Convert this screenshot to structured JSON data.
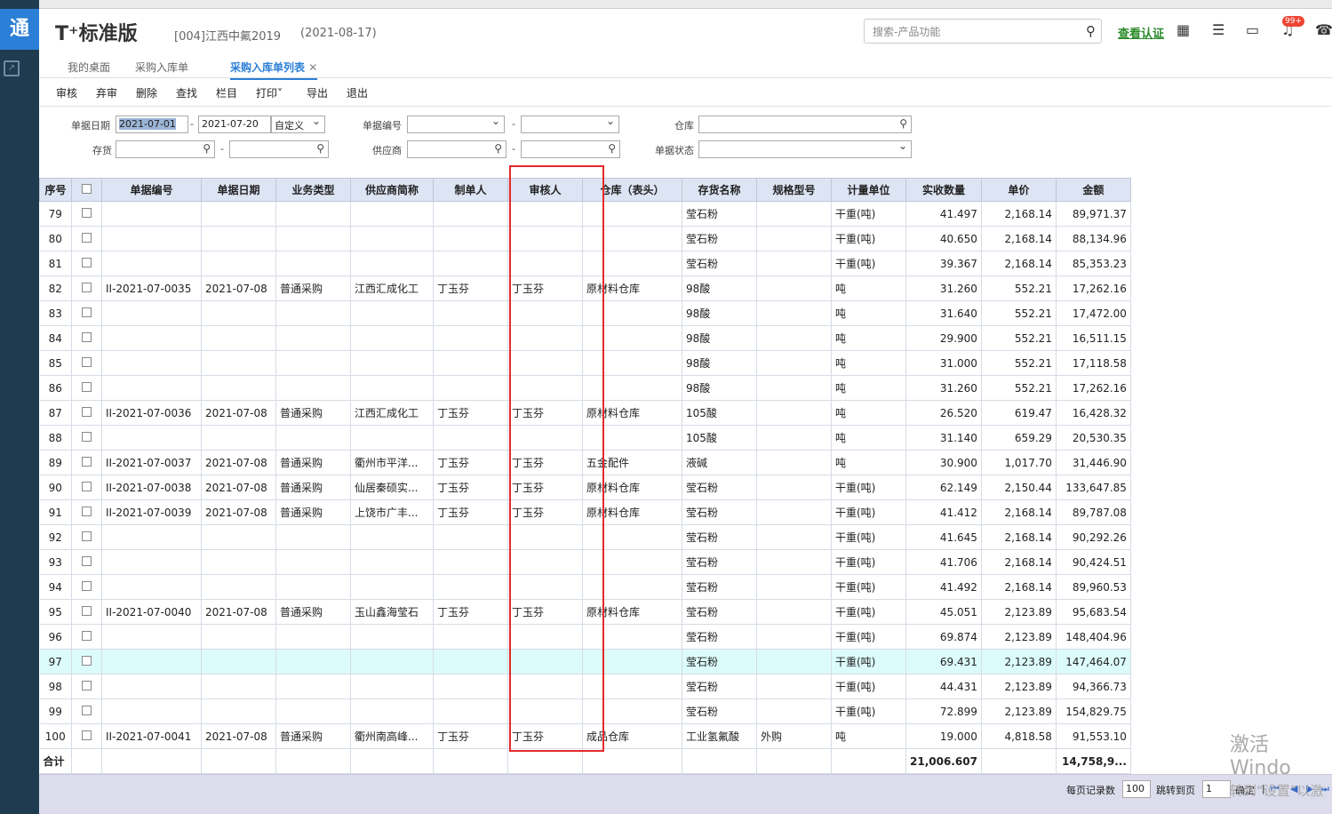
{
  "app": {
    "logo_char": "通",
    "brand": "T⁺标准版",
    "company": "[004]江西中氟2019",
    "date": "(2021-08-17)"
  },
  "header": {
    "search_placeholder": "搜索-产品功能",
    "verify_link": "查看认证",
    "badge": "99+",
    "icons": [
      "calculator-icon",
      "checklist-icon",
      "message-icon",
      "bell-icon",
      "phone-icon"
    ]
  },
  "tabs": [
    "我的桌面",
    "采购入库单",
    "采购入库单列表"
  ],
  "toolbar": [
    "审核",
    "弃审",
    "删除",
    "查找",
    "栏目",
    "打印",
    "导出",
    "退出"
  ],
  "filter": {
    "date_label": "单据日期",
    "date_from": "2021-07-01",
    "date_to": "2021-07-20",
    "date_mode": "自定义",
    "docno_label": "单据编号",
    "warehouse_label": "仓库",
    "inventory_label": "存货",
    "supplier_label": "供应商",
    "status_label": "单据状态",
    "dash": "-"
  },
  "table": {
    "headers": [
      "序号",
      "",
      "单据编号",
      "单据日期",
      "业务类型",
      "供应商简称",
      "制单人",
      "审核人",
      "仓库（表头）",
      "存货名称",
      "规格型号",
      "计量单位",
      "实收数量",
      "单价",
      "金额"
    ],
    "rows": [
      [
        "79",
        "",
        "",
        "",
        "",
        "",
        "",
        "",
        "",
        "莹石粉",
        "",
        "干重(吨)",
        "41.497",
        "2,168.14",
        "89,971.37"
      ],
      [
        "80",
        "",
        "",
        "",
        "",
        "",
        "",
        "",
        "",
        "莹石粉",
        "",
        "干重(吨)",
        "40.650",
        "2,168.14",
        "88,134.96"
      ],
      [
        "81",
        "",
        "",
        "",
        "",
        "",
        "",
        "",
        "",
        "莹石粉",
        "",
        "干重(吨)",
        "39.367",
        "2,168.14",
        "85,353.23"
      ],
      [
        "82",
        "",
        "II-2021-07-0035",
        "2021-07-08",
        "普通采购",
        "江西汇成化工",
        "丁玉芬",
        "丁玉芬",
        "原材料仓库",
        "98酸",
        "",
        "吨",
        "31.260",
        "552.21",
        "17,262.16"
      ],
      [
        "83",
        "",
        "",
        "",
        "",
        "",
        "",
        "",
        "",
        "98酸",
        "",
        "吨",
        "31.640",
        "552.21",
        "17,472.00"
      ],
      [
        "84",
        "",
        "",
        "",
        "",
        "",
        "",
        "",
        "",
        "98酸",
        "",
        "吨",
        "29.900",
        "552.21",
        "16,511.15"
      ],
      [
        "85",
        "",
        "",
        "",
        "",
        "",
        "",
        "",
        "",
        "98酸",
        "",
        "吨",
        "31.000",
        "552.21",
        "17,118.58"
      ],
      [
        "86",
        "",
        "",
        "",
        "",
        "",
        "",
        "",
        "",
        "98酸",
        "",
        "吨",
        "31.260",
        "552.21",
        "17,262.16"
      ],
      [
        "87",
        "",
        "II-2021-07-0036",
        "2021-07-08",
        "普通采购",
        "江西汇成化工",
        "丁玉芬",
        "丁玉芬",
        "原材料仓库",
        "105酸",
        "",
        "吨",
        "26.520",
        "619.47",
        "16,428.32"
      ],
      [
        "88",
        "",
        "",
        "",
        "",
        "",
        "",
        "",
        "",
        "105酸",
        "",
        "吨",
        "31.140",
        "659.29",
        "20,530.35"
      ],
      [
        "89",
        "",
        "II-2021-07-0037",
        "2021-07-08",
        "普通采购",
        "衢州市平洋...",
        "丁玉芬",
        "丁玉芬",
        "五金配件",
        "液碱",
        "",
        "吨",
        "30.900",
        "1,017.70",
        "31,446.90"
      ],
      [
        "90",
        "",
        "II-2021-07-0038",
        "2021-07-08",
        "普通采购",
        "仙居秦硕实...",
        "丁玉芬",
        "丁玉芬",
        "原材料仓库",
        "莹石粉",
        "",
        "干重(吨)",
        "62.149",
        "2,150.44",
        "133,647.85"
      ],
      [
        "91",
        "",
        "II-2021-07-0039",
        "2021-07-08",
        "普通采购",
        "上饶市广丰...",
        "丁玉芬",
        "丁玉芬",
        "原材料仓库",
        "莹石粉",
        "",
        "干重(吨)",
        "41.412",
        "2,168.14",
        "89,787.08"
      ],
      [
        "92",
        "",
        "",
        "",
        "",
        "",
        "",
        "",
        "",
        "莹石粉",
        "",
        "干重(吨)",
        "41.645",
        "2,168.14",
        "90,292.26"
      ],
      [
        "93",
        "",
        "",
        "",
        "",
        "",
        "",
        "",
        "",
        "莹石粉",
        "",
        "干重(吨)",
        "41.706",
        "2,168.14",
        "90,424.51"
      ],
      [
        "94",
        "",
        "",
        "",
        "",
        "",
        "",
        "",
        "",
        "莹石粉",
        "",
        "干重(吨)",
        "41.492",
        "2,168.14",
        "89,960.53"
      ],
      [
        "95",
        "",
        "II-2021-07-0040",
        "2021-07-08",
        "普通采购",
        "玉山鑫海莹石",
        "丁玉芬",
        "丁玉芬",
        "原材料仓库",
        "莹石粉",
        "",
        "干重(吨)",
        "45.051",
        "2,123.89",
        "95,683.54"
      ],
      [
        "96",
        "",
        "",
        "",
        "",
        "",
        "",
        "",
        "",
        "莹石粉",
        "",
        "干重(吨)",
        "69.874",
        "2,123.89",
        "148,404.96"
      ],
      [
        "97",
        "",
        "",
        "",
        "",
        "",
        "",
        "",
        "",
        "莹石粉",
        "",
        "干重(吨)",
        "69.431",
        "2,123.89",
        "147,464.07"
      ],
      [
        "98",
        "",
        "",
        "",
        "",
        "",
        "",
        "",
        "",
        "莹石粉",
        "",
        "干重(吨)",
        "44.431",
        "2,123.89",
        "94,366.73"
      ],
      [
        "99",
        "",
        "",
        "",
        "",
        "",
        "",
        "",
        "",
        "莹石粉",
        "",
        "干重(吨)",
        "72.899",
        "2,123.89",
        "154,829.75"
      ],
      [
        "100",
        "",
        "II-2021-07-0041",
        "2021-07-08",
        "普通采购",
        "衢州南高峰...",
        "丁玉芬",
        "丁玉芬",
        "成品仓库",
        "工业氢氟酸",
        "外购",
        "吨",
        "19.000",
        "4,818.58",
        "91,553.10"
      ]
    ],
    "highlight_row": "97",
    "total_label": "合计",
    "total_qty": "21,006.607",
    "total_amount": "14,758,9..."
  },
  "pager": {
    "per_page_label": "每页记录数",
    "per_page": "100",
    "goto_label": "跳转到页",
    "goto_value": "1",
    "confirm": "确定",
    "sep": "|"
  },
  "watermark": {
    "line1": "激活 Windo",
    "line2": "转到“设置”以激"
  }
}
